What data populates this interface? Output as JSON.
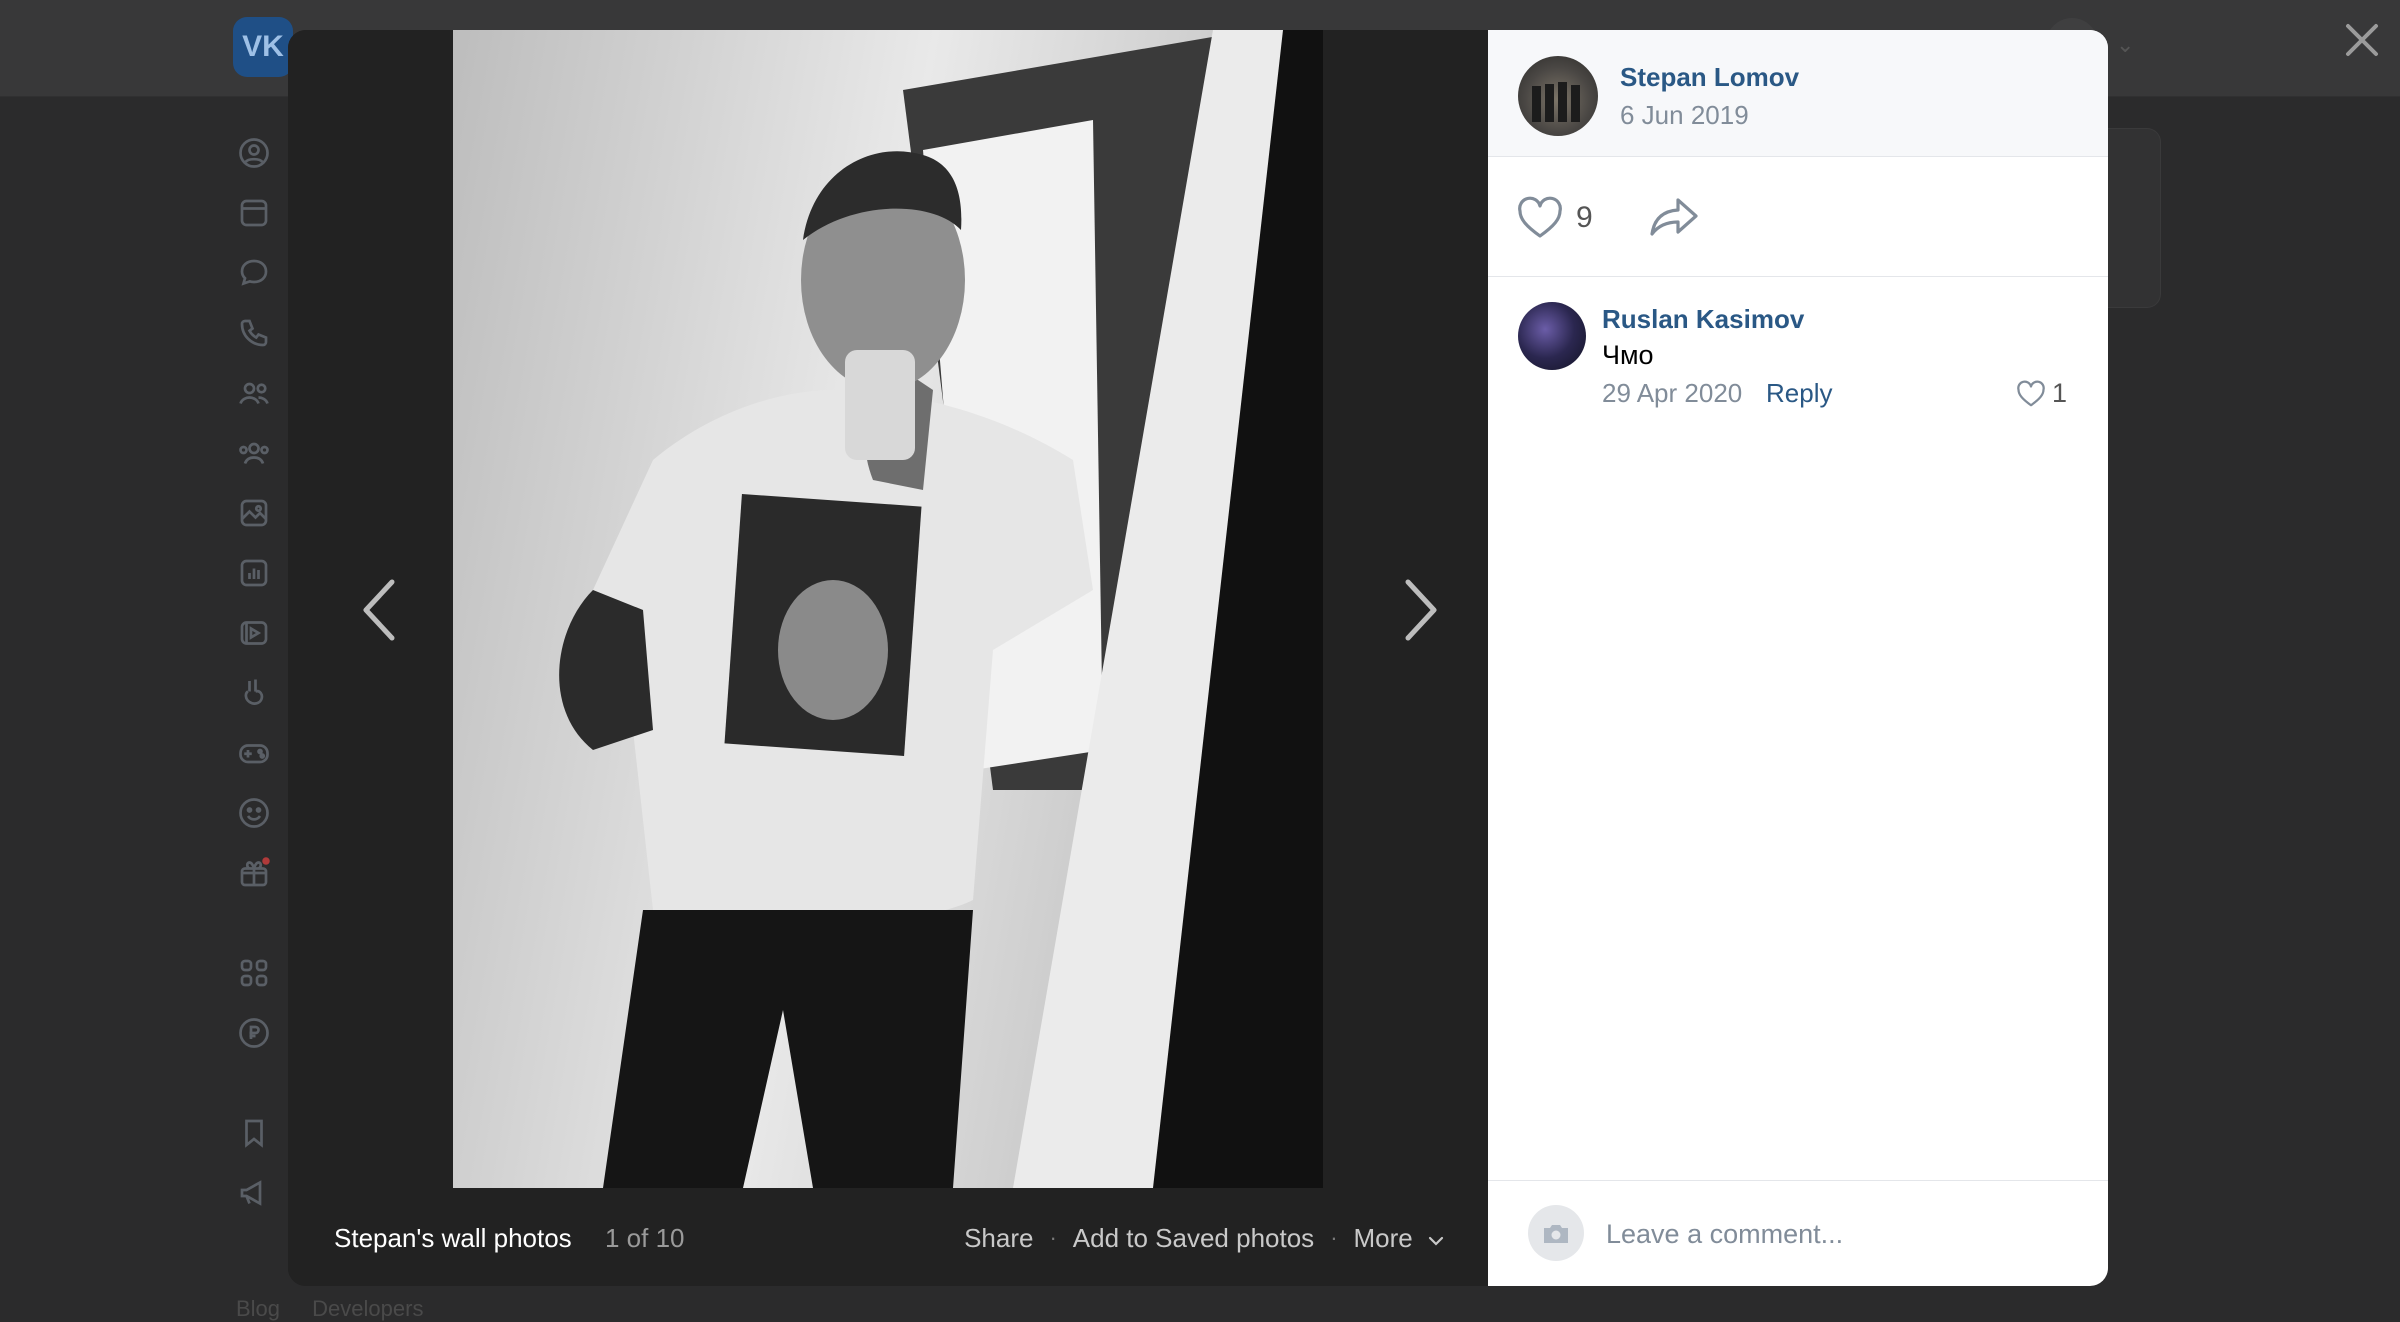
{
  "background": {
    "logo_text": "VK",
    "nav_icons": [
      "profile-icon",
      "news-icon",
      "messenger-icon",
      "calls-icon",
      "friends-icon",
      "communities-icon",
      "photos-icon",
      "music-icon",
      "videos-icon",
      "clips-icon",
      "games-icon",
      "stickers-icon",
      "gifts-icon",
      "services-icon",
      "payments-icon",
      "bookmarks-icon",
      "ads-icon"
    ],
    "footer_links": [
      "Blog",
      "Developers"
    ]
  },
  "viewer": {
    "album_title": "Stepan's wall photos",
    "counter": "1 of 10",
    "actions": {
      "share": "Share",
      "save": "Add to Saved photos",
      "more": "More"
    }
  },
  "post": {
    "author": "Stepan Lomov",
    "date": "6 Jun 2019",
    "likes": "9"
  },
  "comments": [
    {
      "author": "Ruslan Kasimov",
      "text": "Чмо",
      "date": "29 Apr 2020",
      "reply_label": "Reply",
      "likes": "1"
    }
  ],
  "composer": {
    "placeholder": "Leave a comment..."
  },
  "colors": {
    "link": "#2a5885",
    "muted": "#818c99",
    "overlay": "#2b2b2c"
  }
}
